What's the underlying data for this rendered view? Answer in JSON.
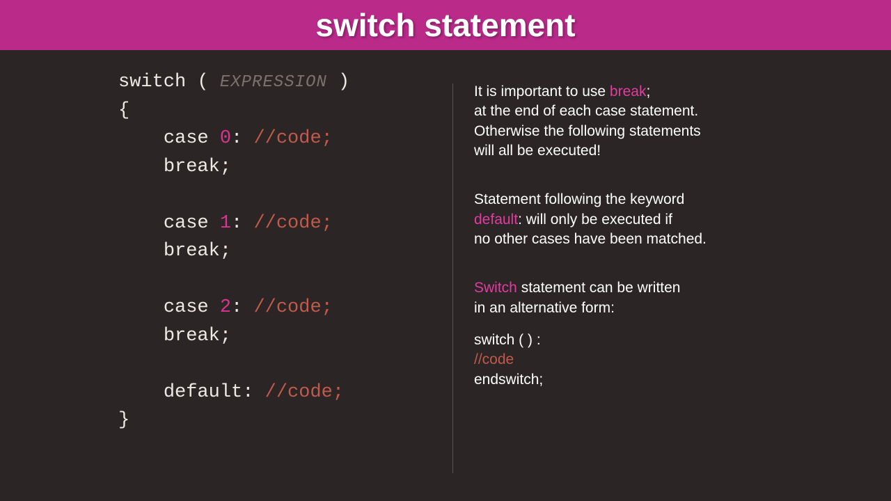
{
  "header": {
    "title": "switch statement"
  },
  "code": {
    "kw_switch": "switch",
    "open_paren": " ( ",
    "expression": "EXPRESSION",
    "close_paren": " )",
    "brace_open": "{",
    "indent": "    ",
    "case_label": "case",
    "cases": [
      {
        "num": "0",
        "comment": "//code;"
      },
      {
        "num": "1",
        "comment": "//code;"
      },
      {
        "num": "2",
        "comment": "//code;"
      }
    ],
    "colon_space": ": ",
    "break_stmt": "break;",
    "default_label": "default",
    "default_comment": "//code;",
    "brace_close": "}"
  },
  "info": {
    "p1_a": "It is important to use ",
    "p1_break": "break",
    "p1_b": ";",
    "p1_c": "at the end of each case statement.",
    "p1_d": "Otherwise the following statements",
    "p1_e": "will all be executed!",
    "p2_a": "Statement following the keyword",
    "p2_default": "default",
    "p2_b": ": will only be executed if",
    "p2_c": "no other cases have been matched.",
    "p3_switch": "Switch",
    "p3_a": " statement can be written",
    "p3_b": "in an alternative form:",
    "alt_line1": "switch ( ) :",
    "alt_line2": "//code",
    "alt_line3": "endswitch;"
  }
}
